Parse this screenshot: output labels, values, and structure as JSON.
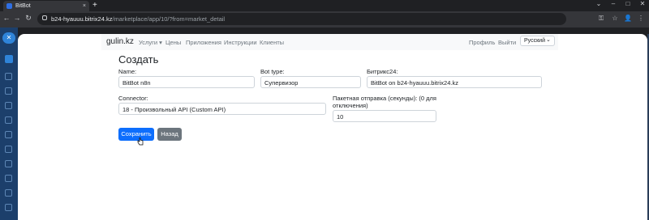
{
  "browser": {
    "tab_title": "BitBot",
    "tab_close": "×",
    "new_tab": "+",
    "window_controls": [
      "⌄",
      "–",
      "□",
      "✕"
    ],
    "url_host": "b24-hyauuu.bitrix24.kz",
    "url_path": "/marketplace/app/10/?from=market_detail",
    "back_icon": "←",
    "forward_icon": "→",
    "reload_icon": "↻",
    "right_icons": [
      "⚿",
      "☆",
      "👤",
      "⋮"
    ]
  },
  "sidebar": {
    "menu_icon": "✕"
  },
  "navbar": {
    "brand": "gulin.kz",
    "links": [
      "Услуги ▾",
      "Цены",
      "Приложения",
      "Инструкции",
      "Клиенты"
    ],
    "right_links": [
      "Профиль",
      "Выйти"
    ],
    "language": "Русский",
    "language_caret": "⌄"
  },
  "form": {
    "title": "Создать",
    "name_label": "Name:",
    "name_value": "BitBot n8n",
    "bot_type_label": "Bot type:",
    "bot_type_value": "Супервизор",
    "bitrix_label": "Битрикс24:",
    "bitrix_value": "BitBot on b24-hyauuu.bitrix24.kz",
    "connector_label": "Connector:",
    "connector_value": "18 - Произвольный API (Custom API)",
    "batch_label_line1": "Пакетная отправка (секунды): (0 для",
    "batch_label_line2": "отключения)",
    "batch_value": "10",
    "save_label": "Сохранить",
    "back_label": "Назад"
  }
}
